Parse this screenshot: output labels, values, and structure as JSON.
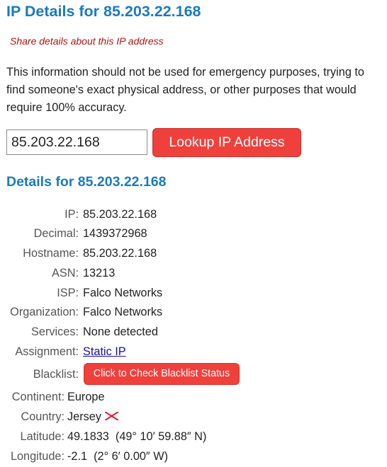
{
  "page_title": "IP Details for 85.203.22.168",
  "share_link": "Share details about this IP address",
  "notice": "This information should not be used for emergency purposes, trying to find someone's exact physical address, or other purposes that would require 100% accuracy.",
  "lookup": {
    "ip_value": "85.203.22.168",
    "button_label": "Lookup IP Address"
  },
  "details_heading": "Details for 85.203.22.168",
  "details": [
    {
      "label": "IP:",
      "value": "85.203.22.168"
    },
    {
      "label": "Decimal:",
      "value": "1439372968"
    },
    {
      "label": "Hostname:",
      "value": "85.203.22.168"
    },
    {
      "label": "ASN:",
      "value": "13213"
    },
    {
      "label": "ISP:",
      "value": "Falco Networks"
    },
    {
      "label": "Organization:",
      "value": "Falco Networks"
    },
    {
      "label": "Services:",
      "value": "None detected"
    },
    {
      "label": "Assignment:",
      "value": "Static IP"
    },
    {
      "label": "Blacklist:",
      "value": "Click to Check Blacklist Status"
    }
  ],
  "location": [
    {
      "label": "Continent:",
      "value": "Europe"
    },
    {
      "label": "Country:",
      "value": "Jersey"
    },
    {
      "label": "Latitude:",
      "value": "49.1833  (49° 10′ 59.88″ N)"
    },
    {
      "label": "Longitude:",
      "value": "-2.1  (2° 6′ 0.00″ W)"
    }
  ],
  "colors": {
    "heading": "#1b7abf",
    "button": "#f0403c",
    "share_link": "#b01212",
    "link": "#1a0dab"
  },
  "icons": {
    "country_flag": "jersey-flag-icon"
  }
}
